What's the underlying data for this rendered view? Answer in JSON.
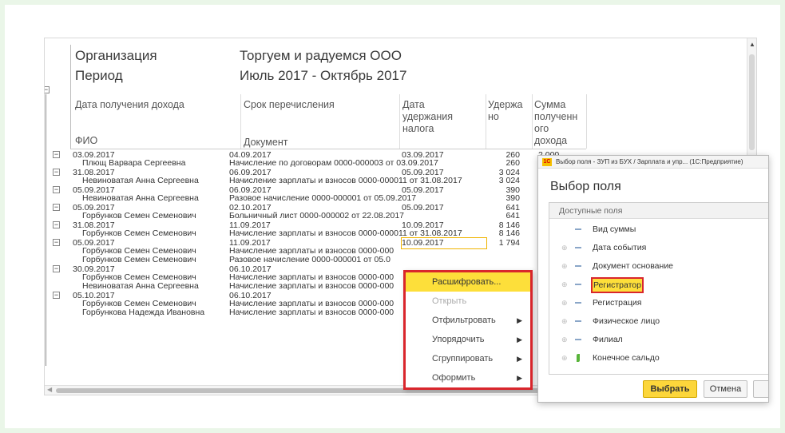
{
  "report": {
    "org_label": "Организация",
    "org_value": "Торгуем и радуемся ООО",
    "period_label": "Период",
    "period_value": "Июль 2017 - Октябрь 2017",
    "col_income_date": "Дата получения дохода",
    "col_fio": "ФИО",
    "col_transfer": "Срок перечисления",
    "col_document": "Документ",
    "col_withhold_date": "Дата\nудержания\nналога",
    "col_withheld": "Удержа\nно",
    "col_income_sum": "Сумма\nполученн\nого\nдохода",
    "rows": [
      {
        "c1": "03.09.2017",
        "c2": "04.09.2017",
        "c3": "03.09.2017",
        "c4": "260",
        "c5": "2 000",
        "kind": "group"
      },
      {
        "c1": "Плющ Варвара Сергеевна",
        "c2": "Начисление по договорам 0000-000003 от 03.09.2017",
        "c3": "",
        "c4": "260",
        "kind": "child"
      },
      {
        "c1": "31.08.2017",
        "c2": "06.09.2017",
        "c3": "05.09.2017",
        "c4": "3 024",
        "kind": "group"
      },
      {
        "c1": "Невиноватая Анна Сергеевна",
        "c2": "Начисление зарплаты и взносов 0000-000011 от 31.08.2017",
        "c3": "",
        "c4": "3 024",
        "kind": "child"
      },
      {
        "c1": "05.09.2017",
        "c2": "06.09.2017",
        "c3": "05.09.2017",
        "c4": "390",
        "kind": "group"
      },
      {
        "c1": "Невиноватая Анна Сергеевна",
        "c2": "Разовое начисление 0000-000001 от 05.09.2017",
        "c3": "",
        "c4": "390",
        "kind": "child"
      },
      {
        "c1": "05.09.2017",
        "c2": "02.10.2017",
        "c3": "05.09.2017",
        "c4": "641",
        "kind": "group"
      },
      {
        "c1": "Горбунков Семен Семенович",
        "c2": "Больничный лист 0000-000002 от 22.08.2017",
        "c3": "",
        "c4": "641",
        "kind": "child"
      },
      {
        "c1": "31.08.2017",
        "c2": "11.09.2017",
        "c3": "10.09.2017",
        "c4": "8 146",
        "kind": "group"
      },
      {
        "c1": "Горбунков Семен Семенович",
        "c2": "Начисление зарплаты и взносов 0000-000011 от 31.08.2017",
        "c3": "",
        "c4": "8 146",
        "kind": "child"
      },
      {
        "c1": "05.09.2017",
        "c2": "11.09.2017",
        "c3": "10.09.2017",
        "c4": "1 794",
        "kind": "group"
      },
      {
        "c1": "Горбунков Семен Семенович",
        "c2": "Начисление зарплаты и взносов 0000-000",
        "c3": "",
        "c4": "",
        "kind": "child"
      },
      {
        "c1": "Горбунков Семен Семенович",
        "c2": "Разовое начисление 0000-000001 от 05.0",
        "c3": "",
        "c4": "",
        "kind": "child"
      },
      {
        "c1": "30.09.2017",
        "c2": "06.10.2017",
        "c3": "",
        "c4": "",
        "kind": "group"
      },
      {
        "c1": "Горбунков Семен Семенович",
        "c2": "Начисление зарплаты и взносов 0000-000",
        "c3": "",
        "c4": "",
        "kind": "child"
      },
      {
        "c1": "Невиноватая Анна Сергеевна",
        "c2": "Начисление зарплаты и взносов 0000-000",
        "c3": "",
        "c4": "",
        "kind": "child"
      },
      {
        "c1": "05.10.2017",
        "c2": "06.10.2017",
        "c3": "",
        "c4": "",
        "kind": "group"
      },
      {
        "c1": "Горбунков Семен Семенович",
        "c2": "Начисление зарплаты и взносов 0000-000",
        "c3": "",
        "c4": "",
        "kind": "child"
      },
      {
        "c1": "Горбункова Надежда Ивановна",
        "c2": "Начисление зарплаты и взносов 0000-000",
        "c3": "",
        "c4": "",
        "kind": "child"
      }
    ]
  },
  "context_menu": {
    "items": [
      {
        "label": "Расшифровать...",
        "state": "highlighted",
        "submenu": false
      },
      {
        "label": "Открыть",
        "state": "disabled",
        "submenu": false
      },
      {
        "label": "Отфильтровать",
        "state": "normal",
        "submenu": true
      },
      {
        "label": "Упорядочить",
        "state": "normal",
        "submenu": true
      },
      {
        "label": "Сгруппировать",
        "state": "normal",
        "submenu": true
      },
      {
        "label": "Оформить",
        "state": "normal",
        "submenu": true
      }
    ]
  },
  "dialog": {
    "titlebar": "Выбор поля - ЗУП из БУХ / Зарплата и упр... (1С:Предприятие)",
    "logo_text": "1С",
    "heading": "Выбор поля",
    "list_header": "Доступные поля",
    "fields": [
      {
        "label": "Вид суммы",
        "expand": false,
        "icon": "dash",
        "highlight": false
      },
      {
        "label": "Дата события",
        "expand": true,
        "icon": "dash",
        "highlight": false
      },
      {
        "label": "Документ основание",
        "expand": true,
        "icon": "dash",
        "highlight": false
      },
      {
        "label": "Регистратор",
        "expand": true,
        "icon": "dash",
        "highlight": true
      },
      {
        "label": "Регистрация",
        "expand": true,
        "icon": "dash",
        "highlight": false
      },
      {
        "label": "Физическое лицо",
        "expand": true,
        "icon": "dash",
        "highlight": false
      },
      {
        "label": "Филиал",
        "expand": true,
        "icon": "dash",
        "highlight": false
      },
      {
        "label": "Конечное сальдо",
        "expand": true,
        "icon": "leaf",
        "highlight": false
      }
    ],
    "select_label": "Выбрать",
    "cancel_label": "Отмена"
  },
  "colors": {
    "accent_yellow": "#fddf3a",
    "highlight_red": "#d9262c",
    "frame_green": "#eaf6e8"
  }
}
